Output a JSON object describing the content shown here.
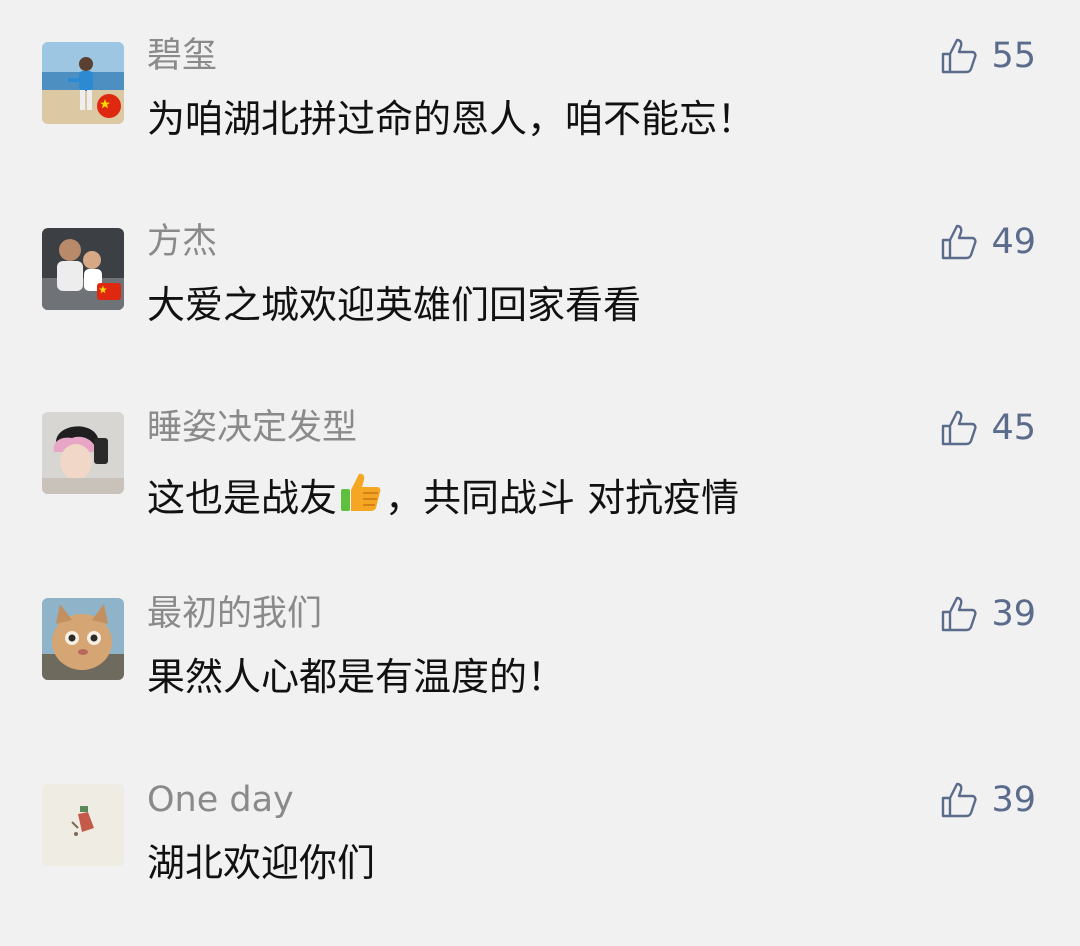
{
  "colors": {
    "background": "#f1f1f1",
    "nickname": "#8a8a8a",
    "content": "#111111",
    "like_accent": "#5b6b8c"
  },
  "like_icon": "thumbs-up-outline-icon",
  "comments": [
    {
      "nickname": "碧玺",
      "content": "为咱湖北拼过命的恩人，咱不能忘！",
      "likes": "55",
      "avatar": "man-on-beach-with-china-flag-badge"
    },
    {
      "nickname": "方杰",
      "content": "大爱之城欢迎英雄们回家看看",
      "likes": "49",
      "avatar": "man-with-child-with-china-flag-badge"
    },
    {
      "nickname": "睡姿决定发型",
      "content_before": "这也是战友",
      "content_emoji": "thumbs-up-emoji",
      "content_after": "，共同战斗 对抗疫情",
      "likes": "45",
      "avatar": "person-pink-hair-selfie"
    },
    {
      "nickname": "最初的我们",
      "content": "果然人心都是有温度的！",
      "likes": "39",
      "avatar": "cat-face"
    },
    {
      "nickname": "One day",
      "content": "湖北欢迎你们",
      "likes": "39",
      "avatar": "minimal-illustration"
    }
  ]
}
